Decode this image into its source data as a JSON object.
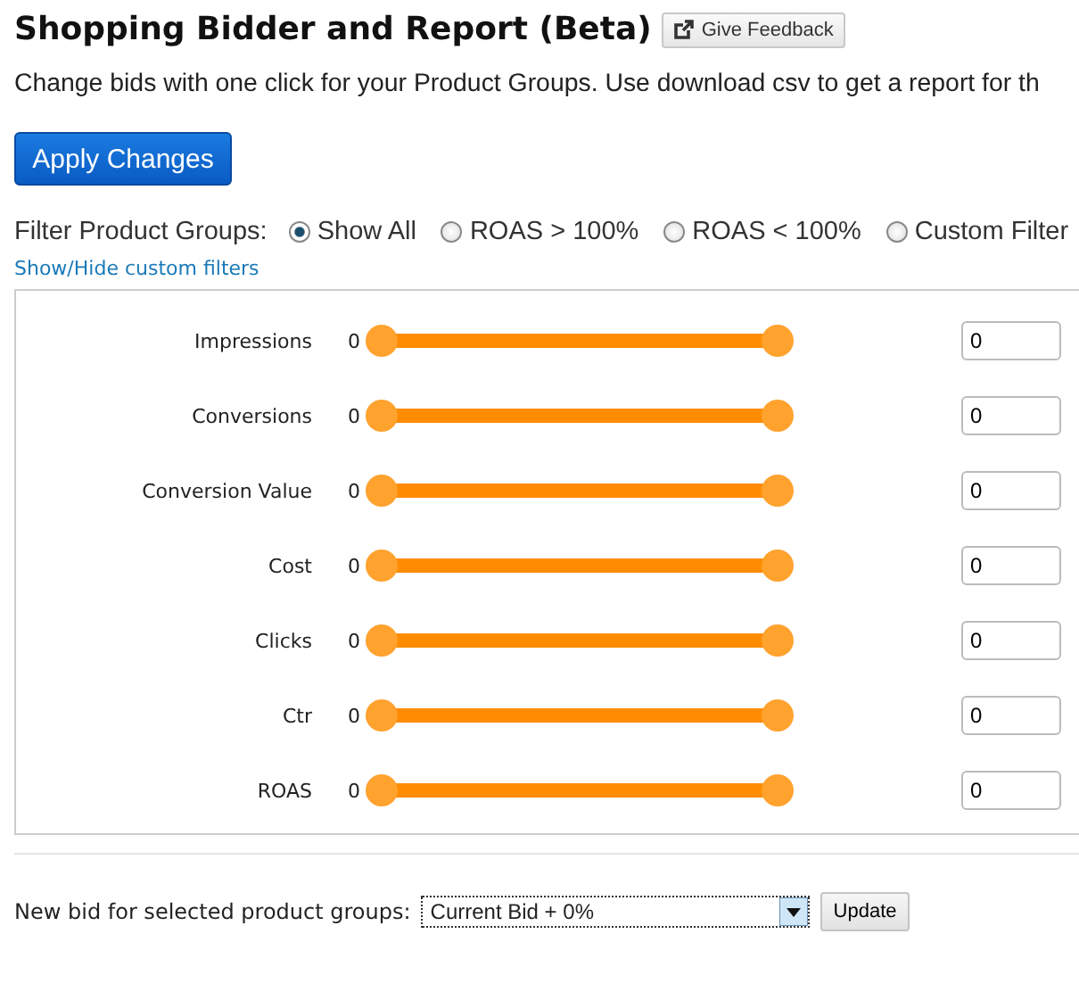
{
  "header": {
    "title": "Shopping Bidder and Report (Beta)",
    "feedback_button": "Give Feedback"
  },
  "description": "Change bids with one click for your Product Groups. Use download csv to get a report for th",
  "apply_button": "Apply Changes",
  "filter": {
    "label": "Filter Product Groups:",
    "options": [
      {
        "label": "Show All",
        "selected": true
      },
      {
        "label": "ROAS > 100%",
        "selected": false
      },
      {
        "label": "ROAS < 100%",
        "selected": false
      },
      {
        "label": "Custom Filter",
        "selected": false
      }
    ]
  },
  "toggle_link": "Show/Hide custom filters",
  "custom_filters": [
    {
      "name": "Impressions",
      "min_label": "0",
      "level": 1,
      "value": "0"
    },
    {
      "name": "Conversions",
      "min_label": "0",
      "level": 1,
      "value": "0"
    },
    {
      "name": "Conversion Value",
      "min_label": "0",
      "level": 1,
      "value": "0"
    },
    {
      "name": "Cost",
      "min_label": "0",
      "level": 1,
      "value": "0"
    },
    {
      "name": "Clicks",
      "min_label": "0",
      "level": 1,
      "value": "0"
    },
    {
      "name": "Ctr",
      "min_label": "0",
      "level": 1,
      "value": "0"
    },
    {
      "name": "ROAS",
      "min_label": "0",
      "level": 1,
      "value": "0"
    }
  ],
  "new_bid": {
    "label": "New bid for selected product groups:",
    "value": "Current Bid + 0%",
    "button": "Update"
  }
}
